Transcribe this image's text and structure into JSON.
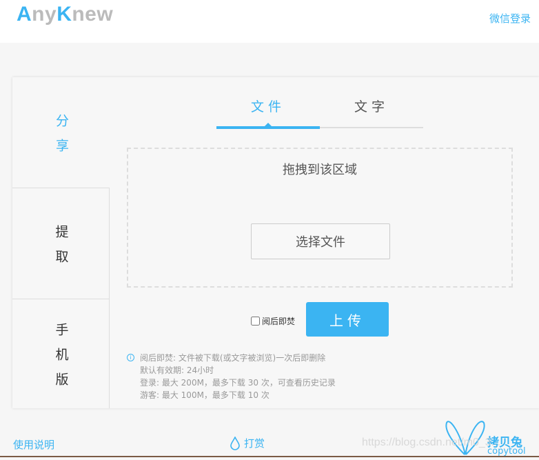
{
  "header": {
    "logo_a": "A",
    "logo_ny": "ny",
    "logo_k": "K",
    "logo_new": "new",
    "wechat_login": "微信登录"
  },
  "sidebar": {
    "items": [
      {
        "label": "分享",
        "chars": [
          "分",
          "享"
        ],
        "active": true
      },
      {
        "label": "提取",
        "chars": [
          "提",
          "取"
        ]
      },
      {
        "label": "手机版",
        "chars": [
          "手",
          "机",
          "版"
        ]
      }
    ]
  },
  "tabs": [
    {
      "label": "文件",
      "active": true
    },
    {
      "label": "文字"
    }
  ],
  "dropzone": {
    "text": "拖拽到该区域",
    "choose_button": "选择文件"
  },
  "burn_checkbox": {
    "label": "阅后即焚",
    "checked": false
  },
  "upload_button": "上传",
  "notes": [
    "阅后即焚: 文件被下载(或文字被浏览)一次后即删除",
    "默认有效期: 24小时",
    "登录: 最大 200M，最多下载 30 次，可查看历史记录",
    "游客: 最大 100M，最多下载 10 次"
  ],
  "footer": {
    "help": "使用说明",
    "tip": "打赏",
    "brand_cn": "拷贝兔",
    "brand_en": "copytool"
  },
  "watermark": "https://blog.csdn.net/m0_3...",
  "colors": {
    "accent": "#3bb4f2"
  }
}
